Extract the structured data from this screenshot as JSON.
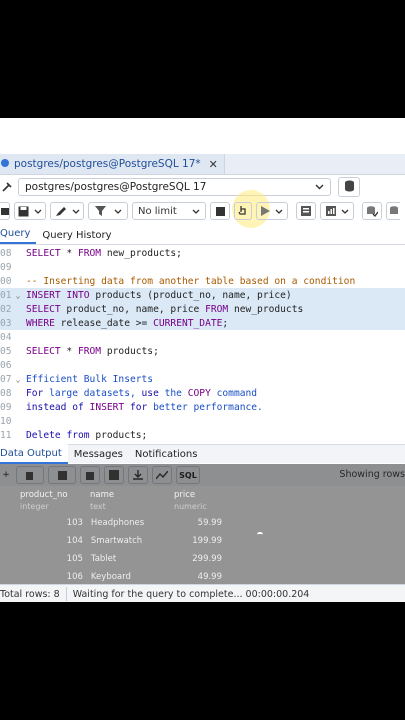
{
  "tab": {
    "title": "postgres/postgres@PostgreSQL 17*",
    "close": "✕"
  },
  "connection": {
    "value": "postgres/postgres@PostgreSQL 17"
  },
  "toolbar": {
    "limit_label": "No limit"
  },
  "query_tabs": [
    {
      "label": "Query"
    },
    {
      "label": "Query History"
    }
  ],
  "editor": {
    "lines": [
      {
        "num": "08",
        "code": "SELECT * FROM new_products;"
      },
      {
        "num": "09",
        "code": ""
      },
      {
        "num": "00",
        "code": "-- Inserting data from another table based on a condition"
      },
      {
        "num": "01",
        "code": "INSERT INTO products (product_no, name, price)"
      },
      {
        "num": "02",
        "code": "SELECT product_no, name, price FROM new_products"
      },
      {
        "num": "03",
        "code": "WHERE release_date >= CURRENT_DATE;"
      },
      {
        "num": "04",
        "code": ""
      },
      {
        "num": "05",
        "code": "SELECT * FROM products;"
      },
      {
        "num": "06",
        "code": ""
      },
      {
        "num": "07",
        "code": "Efficient Bulk Inserts"
      },
      {
        "num": "08",
        "code": "For large datasets, use the COPY command"
      },
      {
        "num": "09",
        "code": "instead of INSERT for better performance."
      },
      {
        "num": "10",
        "code": ""
      },
      {
        "num": "11",
        "code": "Delete from products;"
      }
    ]
  },
  "result_tabs": [
    {
      "label": "Data Output"
    },
    {
      "label": "Messages"
    },
    {
      "label": "Notifications"
    }
  ],
  "results": {
    "showing": "Showing rows",
    "columns": [
      {
        "name": "product_no",
        "type": "integer"
      },
      {
        "name": "name",
        "type": "text"
      },
      {
        "name": "price",
        "type": "numeric"
      }
    ],
    "rows": [
      [
        "103",
        "Headphones",
        "59.99"
      ],
      [
        "104",
        "Smartwatch",
        "199.99"
      ],
      [
        "105",
        "Tablet",
        "299.99"
      ],
      [
        "106",
        "Keyboard",
        "49.99"
      ]
    ]
  },
  "overlay": {
    "message": "Waiting for the query to complete..."
  },
  "status": {
    "total_rows": "Total rows: 8",
    "message": "Waiting for the query to complete... 00:00:00.204"
  }
}
